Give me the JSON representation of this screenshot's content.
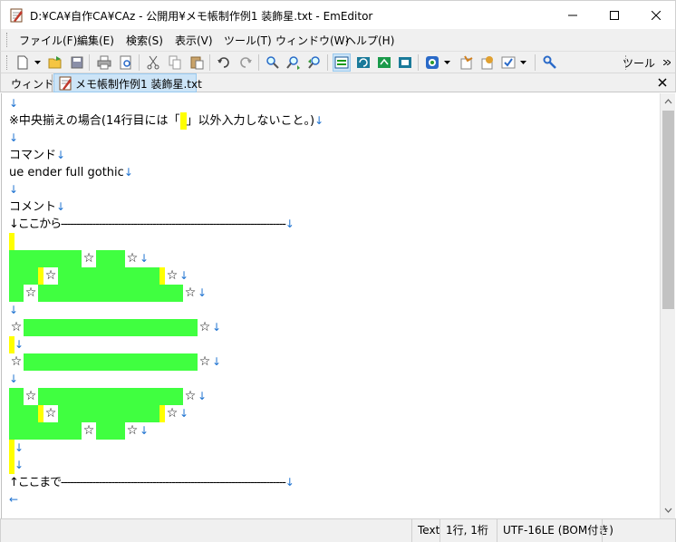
{
  "window": {
    "title": "D:¥CA¥自作CA¥CAz - 公開用¥メモ帳制作例1 装飾星.txt - EmEditor"
  },
  "menu": [
    {
      "label": "ファイル(F)"
    },
    {
      "label": "編集(E)"
    },
    {
      "label": "検索(S)"
    },
    {
      "label": "表示(V)"
    },
    {
      "label": "ツール(T)"
    },
    {
      "label": "ウィンドウ(W)"
    },
    {
      "label": "ヘルプ(H)"
    }
  ],
  "toolbar": {
    "label": "ツール",
    "icons": [
      "new-file-icon",
      "open-file-icon",
      "save-icon",
      "print-icon",
      "print-preview-icon",
      "cut-icon",
      "copy-icon",
      "paste-icon",
      "undo-icon",
      "redo-icon",
      "find-icon",
      "find-next-icon",
      "find-previous-icon",
      "highlight-icon",
      "replace-icon",
      "replace-all-icon",
      "select-all-icon",
      "macro-icon",
      "plugin-icon",
      "config-icon",
      "customize-icon",
      "tool-icon"
    ]
  },
  "tabs": {
    "window_label": "ウィンドウ",
    "active_tab": "メモ帳制作例1 装飾星.txt"
  },
  "editor": {
    "lines": {
      "l2": "※中央揃えの場合(14行目には「",
      "l2b": "」以外入力しないこと。)",
      "l4": "コマンド",
      "l5": "ue ender full gothic",
      "l7": "コメント",
      "l8": "↓ここから-----------------------------------------------------------------------",
      "l26": "↑ここまで-----------------------------------------------------------------------"
    },
    "lf": "↓",
    "eof": "←",
    "star": "☆",
    "colors": {
      "highlight_green": "#40ff40",
      "highlight_yellow": "#ffff00",
      "newline_blue": "#1f73d1"
    }
  },
  "status": {
    "mode": "Text",
    "position": "1行, 1桁",
    "encoding": "UTF-16LE (BOM付き)"
  }
}
